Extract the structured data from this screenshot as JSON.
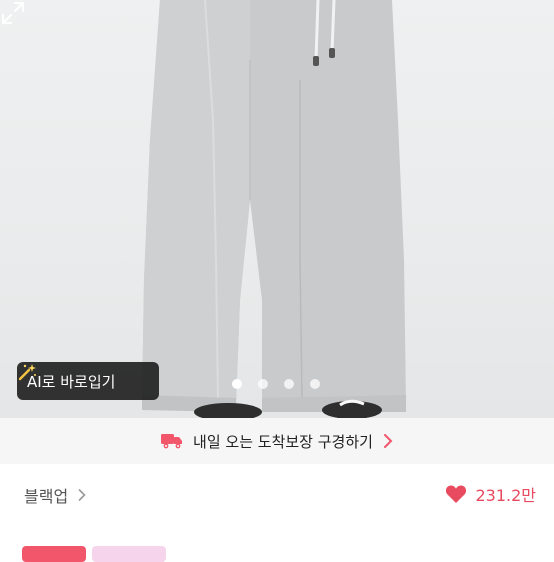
{
  "hero": {
    "ai_button_label": "AI로 바로입기",
    "carousel_dot_count": 4,
    "carousel_active_index": 0
  },
  "delivery": {
    "label": "내일 오는 도착보장 구경하기"
  },
  "seller": {
    "shop_name": "블랙업",
    "likes_count": "231.2만"
  },
  "colors": {
    "accent": "#e84a5f",
    "tag_red": "#f2566a",
    "tag_pink": "#f6d4ec"
  }
}
